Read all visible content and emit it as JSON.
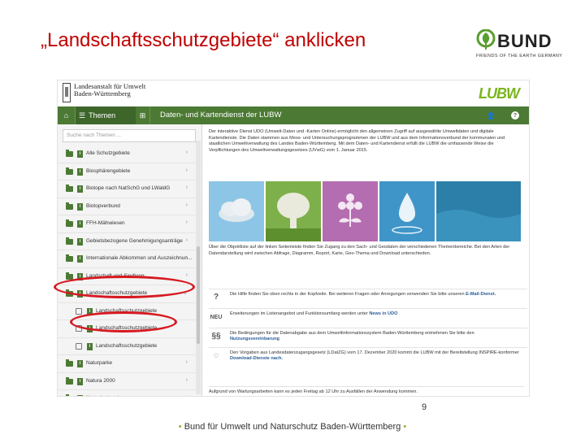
{
  "slide": {
    "title": "„Landschaftsschutzgebiete“ anklicken",
    "page_number": "9",
    "footer_text": "Bund für Umwelt und Naturschutz  Baden-Württemberg",
    "footer_bullet": "•"
  },
  "bund_logo": {
    "word": "BUND",
    "tagline": "FRIENDS OF THE EARTH GERMANY"
  },
  "screenshot": {
    "header": {
      "org_line1": "Landesanstalt für Umwelt",
      "org_line2": "Baden-Württemberg",
      "logo_text": "LUBW"
    },
    "navbar": {
      "home_icon": "⌂",
      "themes_icon": "☰",
      "themes_label": "Themen",
      "grid_icon": "⊞",
      "title": "Daten- und Kartendienst der LUBW",
      "user_icon": "👤",
      "help_icon": "?"
    },
    "sidebar": {
      "search_placeholder": "Suche nach Themen ...",
      "items": [
        {
          "label": "Alle Schutzgebiete",
          "level": 0,
          "chev": "›"
        },
        {
          "label": "Biosphärengebiete",
          "level": 0,
          "chev": "›"
        },
        {
          "label": "Biotope nach NatSchG und LWaldG",
          "level": 0,
          "chev": "›"
        },
        {
          "label": "Biotopverbund",
          "level": 0,
          "chev": "›"
        },
        {
          "label": "FFH-Mähwiesen",
          "level": 0,
          "chev": "›"
        },
        {
          "label": "Gebietsbezogene Genehmigungsanträge",
          "level": 0,
          "chev": "›"
        },
        {
          "label": "Internationale Abkommen und Auszeichnun...",
          "level": 0,
          "chev": "›"
        },
        {
          "label": "Landschaft und Siedlung",
          "level": 0,
          "chev": "›"
        },
        {
          "label": "Landschaftsschutzgebiete",
          "level": 0,
          "chev": "⌄"
        },
        {
          "label": "Landschaftsschutzgebiete",
          "level": 1,
          "chev": ""
        },
        {
          "label": "Landschaftsschutzgebiete",
          "level": 1,
          "chev": ""
        },
        {
          "label": "Landschaftsschutzgebiete",
          "level": 1,
          "chev": ""
        },
        {
          "label": "Naturparke",
          "level": 0,
          "chev": "›"
        },
        {
          "label": "Natura 2000",
          "level": 0,
          "chev": "›"
        },
        {
          "label": "Naturdenkmale",
          "level": 0,
          "chev": "›"
        }
      ]
    },
    "content": {
      "intro": "Der interaktive Dienst UDO (Umwelt-Daten und -Karten Online) ermöglicht den allgemeinen Zugriff auf ausgewählte Umweltdaten und digitale Kartendienste. Die Daten stammen aus Mess- und Untersuchungsprogrammen der LUBW und aus dem Informationsverbund der kommunalen und staatlichen Umweltverwaltung des Landes Baden-Württemberg. Mit dem Daten- und Kartendienst erfüllt die LUBW die umfassende Weise die Verpflichtungen des Umweltverwaltungsgesetzes (UVwG) vom 1. Januar 2015.",
      "intro_2": "Über die Objektliste auf der linken Seitenleiste finden Sie Zugang zu den Sach- und Geodaten der verschiedenen Themenbereiche. Bei den Arten der Datendarstellung wird zwischen Abfrage, Diagramm, Report, Karte, Geo-Thema und Download unterschieden.",
      "info_rows": [
        {
          "icon": "?",
          "text": "Die Hilfe finden Sie oben rechts in der Kopfzeile. Bei weiteren Fragen oder Anregungen verwenden Sie bitte unseren",
          "link": "E-Mail-Dienst."
        },
        {
          "icon": "NEU",
          "text": "Erweiterungen im Listenangebot und Funktionsumfang werden unter",
          "link": "News in UDO"
        },
        {
          "icon": "§§",
          "text": "Die Bedingungen für die Datenabgabe aus dem Umweltinformationssystem Baden-Württemberg entnehmen Sie bitte den",
          "link": "Nutzungsvereinbarung"
        },
        {
          "icon": "◌",
          "text": "Den Vorgaben aus Landesdatenzugangsgesetz (LDatZG) vom 17. Dezember 2020 kommt die LUBW mit der Bereitstellung INSPIRE-konformer",
          "link": "Download-Dienste nach."
        }
      ],
      "footer_note": "Aufgrund von Wartungsarbeiten kann es jeden Freitag ab 12 Uhr zu Ausfällen der Anwendung kommen."
    }
  }
}
